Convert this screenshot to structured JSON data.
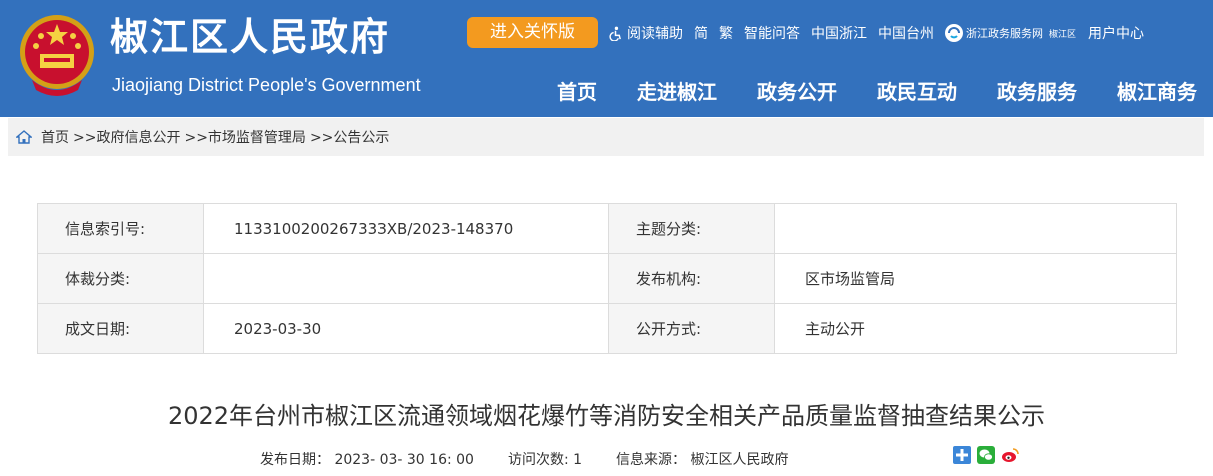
{
  "header": {
    "site_title": "椒江区人民政府",
    "site_subtitle": "Jiaojiang District People's Government",
    "care_button": "进入关怀版",
    "top_links": {
      "reading_aid": "阅读辅助",
      "simplified": "简",
      "traditional": "繁",
      "smart_qa": "智能问答",
      "zhejiang": "中国浙江",
      "taizhou": "中国台州",
      "gov_service": "浙江政务服务网",
      "gov_service_sub": "椒江区",
      "user_center": "用户中心"
    },
    "nav": [
      "首页",
      "走进椒江",
      "政务公开",
      "政民互动",
      "政务服务",
      "椒江商务"
    ],
    "colors": {
      "header_bg": "#3371bd",
      "care_button_bg": "#f39a1f"
    }
  },
  "breadcrumb": {
    "items": [
      "首页",
      ">>政府信息公开",
      ">>市场监督管理局",
      ">>公告公示"
    ]
  },
  "info": {
    "index_label": "信息索引号:",
    "index_value": "113310020026733ЗXB/2023-148370",
    "topic_label": "主题分类:",
    "topic_value": "",
    "genre_label": "体裁分类:",
    "genre_value": "",
    "publisher_label": "发布机构:",
    "publisher_value": "区市场监管局",
    "date_label": "成文日期:",
    "date_value": "2023-03-30",
    "open_label": "公开方式:",
    "open_value": "主动公开"
  },
  "article": {
    "title": "2022年台州市椒江区流通领域烟花爆竹等消防安全相关产品质量监督抽查结果公示",
    "publish_date": "发布日期： 2023- 03- 30 16: 00",
    "visits": "访问次数: 1",
    "source": "信息来源： 椒江区人民政府"
  },
  "icons": {
    "emblem": "national-emblem",
    "reading": "accessibility-icon",
    "home": "home-icon",
    "share": [
      "plus-share-icon",
      "wechat-icon",
      "weibo-icon"
    ]
  }
}
